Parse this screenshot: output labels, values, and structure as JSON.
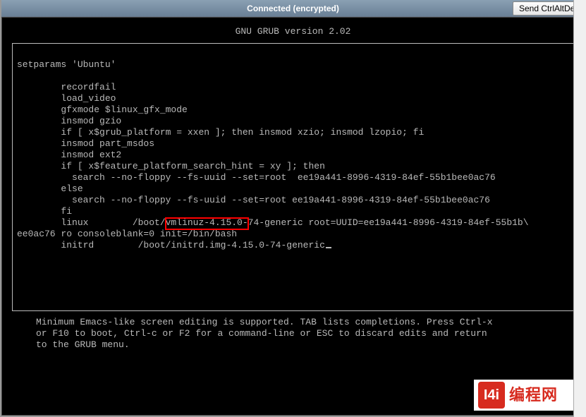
{
  "titlebar": {
    "status": "Connected (encrypted)",
    "ctrl_alt_del": "Send CtrlAltDel"
  },
  "grub": {
    "header": "GNU GRUB  version 2.02",
    "lines": {
      "setparams": "setparams 'Ubuntu'",
      "recordfail": "        recordfail",
      "load_video": "        load_video",
      "gfxmode": "        gfxmode $linux_gfx_mode",
      "insmod_gzio": "        insmod gzio",
      "if_platform": "        if [ x$grub_platform = xxen ]; then insmod xzio; insmod lzopio; fi",
      "insmod_part": "        insmod part_msdos",
      "insmod_ext2": "        insmod ext2",
      "if_feature": "        if [ x$feature_platform_search_hint = xy ]; then",
      "search1": "          search --no-floppy --fs-uuid --set=root  ee19a441-8996-4319-84ef-55b1bee0ac76",
      "else": "        else",
      "search2": "          search --no-floppy --fs-uuid --set=root ee19a441-8996-4319-84ef-55b1bee0ac76",
      "fi": "        fi",
      "linux": "        linux        /boot/vmlinuz-4.15.0-74-generic root=UUID=ee19a441-8996-4319-84ef-55b1b\\",
      "linux_cont": "ee0ac76 ro consoleblank=0 init=/bin/bash",
      "initrd": "        initrd        /boot/initrd.img-4.15.0-74-generic"
    },
    "highlighted": "init=/bin/bash"
  },
  "help": "Minimum Emacs-like screen editing is supported. TAB lists completions. Press Ctrl-x\nor F10 to boot, Ctrl-c or F2 for a command-line or ESC to discard edits and return\nto the GRUB menu.",
  "watermark": {
    "logo": "I4i",
    "text": "编程网"
  }
}
